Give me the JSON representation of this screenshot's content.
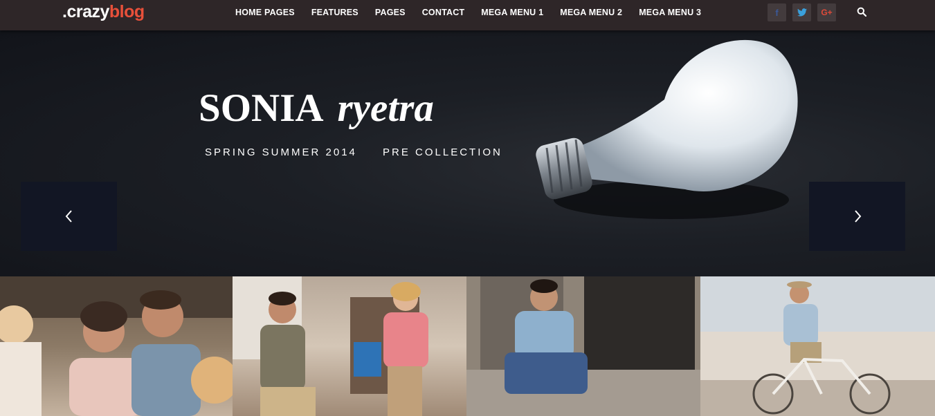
{
  "logo": {
    "part1": ".crazy",
    "part2": "blog"
  },
  "nav": {
    "items": [
      "HOME PAGES",
      "FEATURES",
      "PAGES",
      "CONTACT",
      "MEGA MENU 1",
      "MEGA MENU 2",
      "MEGA MENU 3"
    ]
  },
  "social": {
    "facebook": "f",
    "twitter": "t",
    "googleplus": "G+"
  },
  "hero": {
    "title_word1": "SONIA",
    "title_word2": "ryetra",
    "subtitle1": "SPRING SUMMER 2014",
    "subtitle2": "PRE COLLECTION"
  },
  "icons": {
    "search": "search-icon",
    "prev": "chevron-left-icon",
    "next": "chevron-right-icon"
  },
  "colors": {
    "accent": "#e8503a",
    "header_bg": "#2e2628",
    "arrow_bg": "#121624"
  }
}
